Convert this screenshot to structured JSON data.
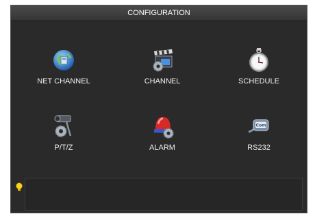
{
  "window": {
    "title": "CONFIGURATION"
  },
  "menu": [
    {
      "label": "NET CHANNEL",
      "icon": "globe-network-icon"
    },
    {
      "label": "CHANNEL",
      "icon": "clapperboard-gear-icon"
    },
    {
      "label": "SCHEDULE",
      "icon": "stopwatch-icon"
    },
    {
      "label": "P/T/Z",
      "icon": "camera-gear-icon"
    },
    {
      "label": "ALARM",
      "icon": "siren-gear-icon"
    },
    {
      "label": "RS232",
      "icon": "serial-port-icon"
    }
  ],
  "tip": {
    "text": "",
    "icon": "lightbulb-icon"
  }
}
